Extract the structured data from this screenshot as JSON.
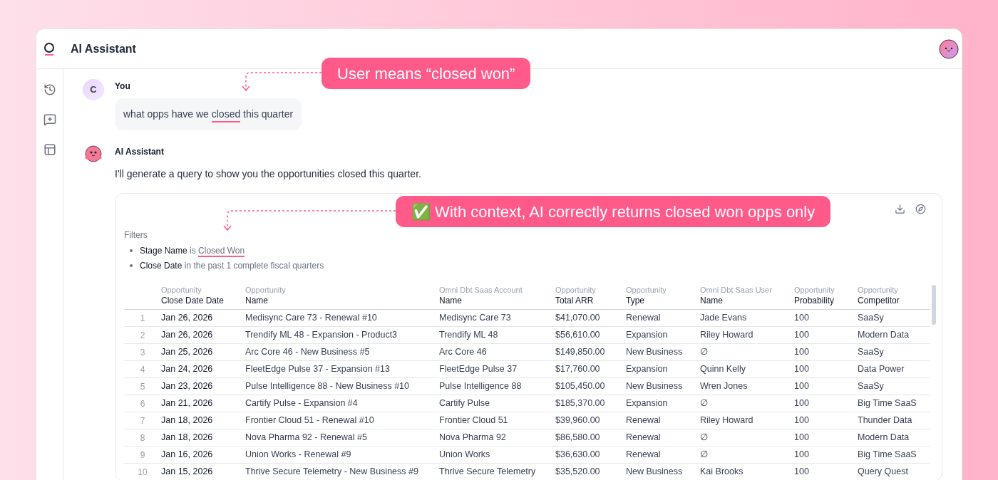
{
  "app": {
    "title": "AI Assistant"
  },
  "messages": [
    {
      "kind": "user",
      "author": "You",
      "avatar": "C",
      "parts": [
        {
          "text": "what opps have we ",
          "underlined": false
        },
        {
          "text": "closed",
          "underlined": true
        },
        {
          "text": " this quarter",
          "underlined": false
        }
      ]
    },
    {
      "kind": "assistant",
      "author": "AI Assistant",
      "parts": [
        {
          "text": "I'll generate a query to show you the opportunities closed this quarter.",
          "underlined": false
        }
      ]
    }
  ],
  "result": {
    "filters_label": "Filters",
    "filters": [
      {
        "field": "Stage Name",
        "operator": "is",
        "value": "Closed Won",
        "underlined": true
      },
      {
        "field": "Close Date",
        "operator": "in the past 1 complete fiscal quarters",
        "underlined": false
      }
    ],
    "table": {
      "columns": [
        {
          "group": "Opportunity",
          "name": "Close Date Date"
        },
        {
          "group": "Opportunity",
          "name": "Name"
        },
        {
          "group": "Omni Dbt Saas Account",
          "name": "Name"
        },
        {
          "group": "Opportunity",
          "name": "Total ARR"
        },
        {
          "group": "Opportunity",
          "name": "Type"
        },
        {
          "group": "Omni Dbt Saas User",
          "name": "Name"
        },
        {
          "group": "Opportunity",
          "name": "Probability"
        },
        {
          "group": "Opportunity",
          "name": "Competitor"
        }
      ],
      "rows": [
        {
          "index": "1",
          "cells": [
            "Jan 26, 2026",
            "Medisync Care 73 - Renewal #10",
            "Medisync Care 73",
            "$41,070.00",
            "Renewal",
            "Jade Evans",
            "100",
            "SaaSy"
          ]
        },
        {
          "index": "2",
          "cells": [
            "Jan 26, 2026",
            "Trendify ML 48 - Expansion - Product3",
            "Trendify ML 48",
            "$56,610.00",
            "Expansion",
            "Riley Howard",
            "100",
            "Modern Data"
          ]
        },
        {
          "index": "3",
          "cells": [
            "Jan 25, 2026",
            "Arc Core 46 - New Business #5",
            "Arc Core 46",
            "$149,850.00",
            "New Business",
            "∅",
            "100",
            "SaaSy"
          ]
        },
        {
          "index": "4",
          "cells": [
            "Jan 24, 2026",
            "FleetEdge Pulse 37 - Expansion #13",
            "FleetEdge Pulse 37",
            "$17,760.00",
            "Expansion",
            "Quinn Kelly",
            "100",
            "Data Power"
          ]
        },
        {
          "index": "5",
          "cells": [
            "Jan 23, 2026",
            "Pulse Intelligence 88 - New Business #10",
            "Pulse Intelligence 88",
            "$105,450.00",
            "New Business",
            "Wren Jones",
            "100",
            "SaaSy"
          ]
        },
        {
          "index": "6",
          "cells": [
            "Jan 21, 2026",
            "Cartify Pulse - Expansion #4",
            "Cartify Pulse",
            "$185,370.00",
            "Expansion",
            "∅",
            "100",
            "Big Time SaaS"
          ]
        },
        {
          "index": "7",
          "cells": [
            "Jan 18, 2026",
            "Frontier Cloud 51 - Renewal #10",
            "Frontier Cloud 51",
            "$39,960.00",
            "Renewal",
            "Riley Howard",
            "100",
            "Thunder Data"
          ]
        },
        {
          "index": "8",
          "cells": [
            "Jan 18, 2026",
            "Nova Pharma 92 - Renewal #5",
            "Nova Pharma 92",
            "$86,580.00",
            "Renewal",
            "∅",
            "100",
            "Modern Data"
          ]
        },
        {
          "index": "9",
          "cells": [
            "Jan 16, 2026",
            "Union Works - Renewal #9",
            "Union Works",
            "$36,630.00",
            "Renewal",
            "∅",
            "100",
            "Big Time SaaS"
          ]
        },
        {
          "index": "10",
          "cells": [
            "Jan 15, 2026",
            "Thrive Secure Telemetry - New Business #9",
            "Thrive Secure Telemetry",
            "$35,520.00",
            "New Business",
            "Kai Brooks",
            "100",
            "Query Quest"
          ]
        }
      ]
    }
  },
  "annotations": [
    {
      "text": "User means “closed won”"
    },
    {
      "text": "✅ With context, AI correctly returns closed won opps only"
    }
  ]
}
